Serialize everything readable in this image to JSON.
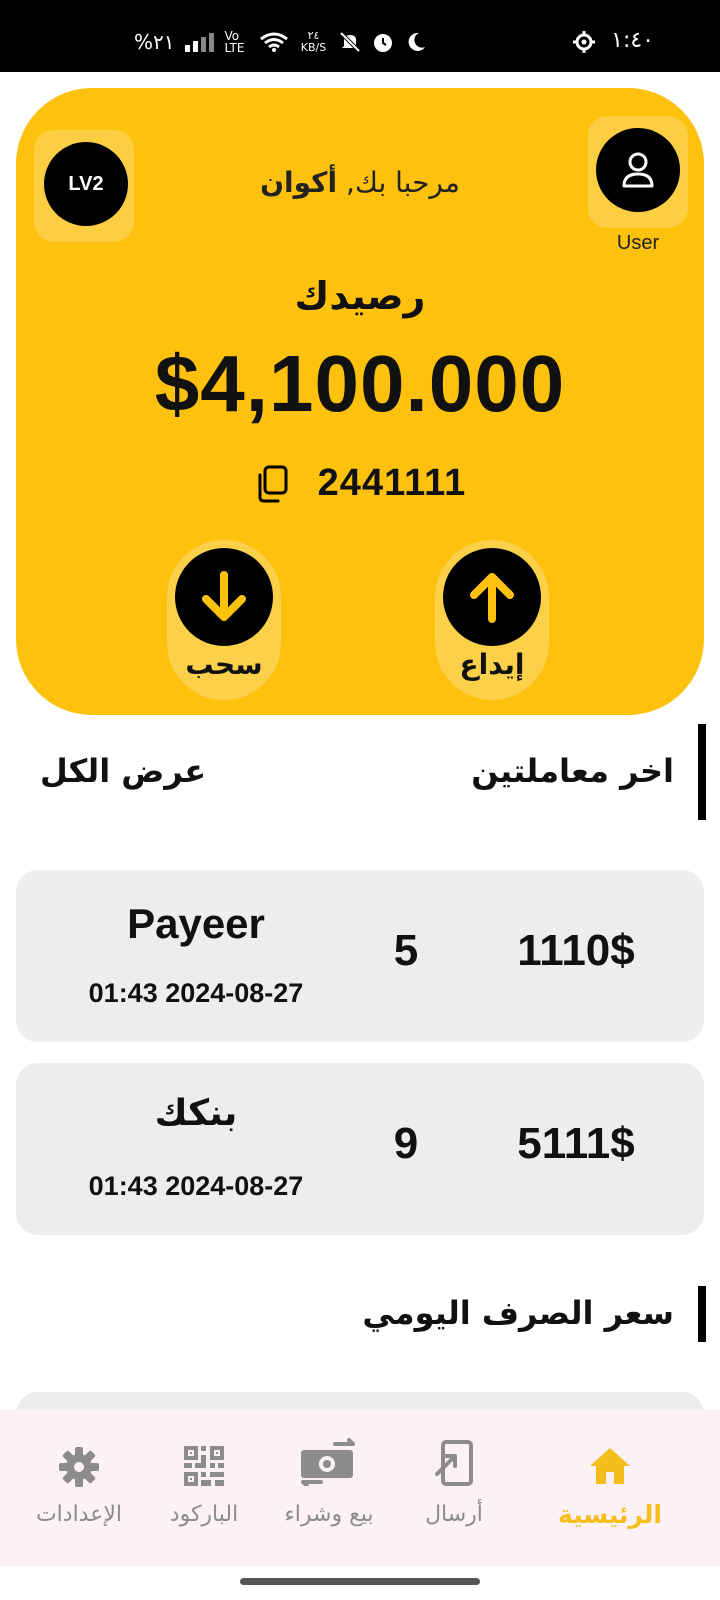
{
  "status_bar": {
    "time": "١:٤٠",
    "battery": "%٢١",
    "network": "Vo LTE",
    "data_speed": "٢٤ KB/S"
  },
  "card": {
    "level_badge": "LV2",
    "user_label": "User",
    "greeting_prefix": "مرحبا بك,",
    "user_name": "أكوان",
    "balance_label": "رصيدك",
    "balance": "$4,100.000",
    "account_number": "2441111",
    "withdraw_label": "سحب",
    "deposit_label": "إيداع",
    "accent_color": "#FDC10E"
  },
  "transactions_section": {
    "title": "اخر معاملتين",
    "view_all": "عرض الكل"
  },
  "transactions": [
    {
      "method": "Payeer",
      "datetime": "01:43 2024-08-27",
      "count": "5",
      "amount": "1110$"
    },
    {
      "method": "بنكك",
      "datetime": "01:43 2024-08-27",
      "count": "9",
      "amount": "5111$"
    }
  ],
  "exchange_section": {
    "title": "سعر الصرف اليومي"
  },
  "bottom_nav": {
    "items": [
      {
        "label": "الإعدادات",
        "icon": "gear-icon"
      },
      {
        "label": "الباركود",
        "icon": "qr-code-icon"
      },
      {
        "label": "بيع وشراء",
        "icon": "money-exchange-icon"
      },
      {
        "label": "أرسال",
        "icon": "send-icon"
      },
      {
        "label": "الرئيسية",
        "icon": "home-icon",
        "active": true
      }
    ],
    "active_color": "#F4BE1B"
  }
}
